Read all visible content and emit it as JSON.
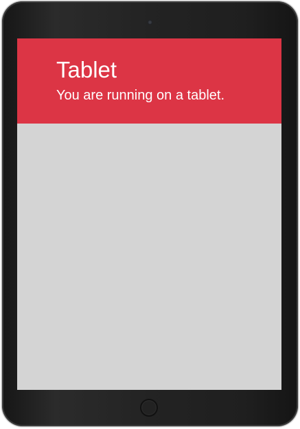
{
  "device": {
    "camera_icon": "camera-icon",
    "home_button_icon": "home-button-icon"
  },
  "header": {
    "title": "Tablet",
    "subtitle": "You are running on a tablet.",
    "accent_color": "#dc3545"
  },
  "content": {
    "background_color": "#d4d4d4"
  }
}
